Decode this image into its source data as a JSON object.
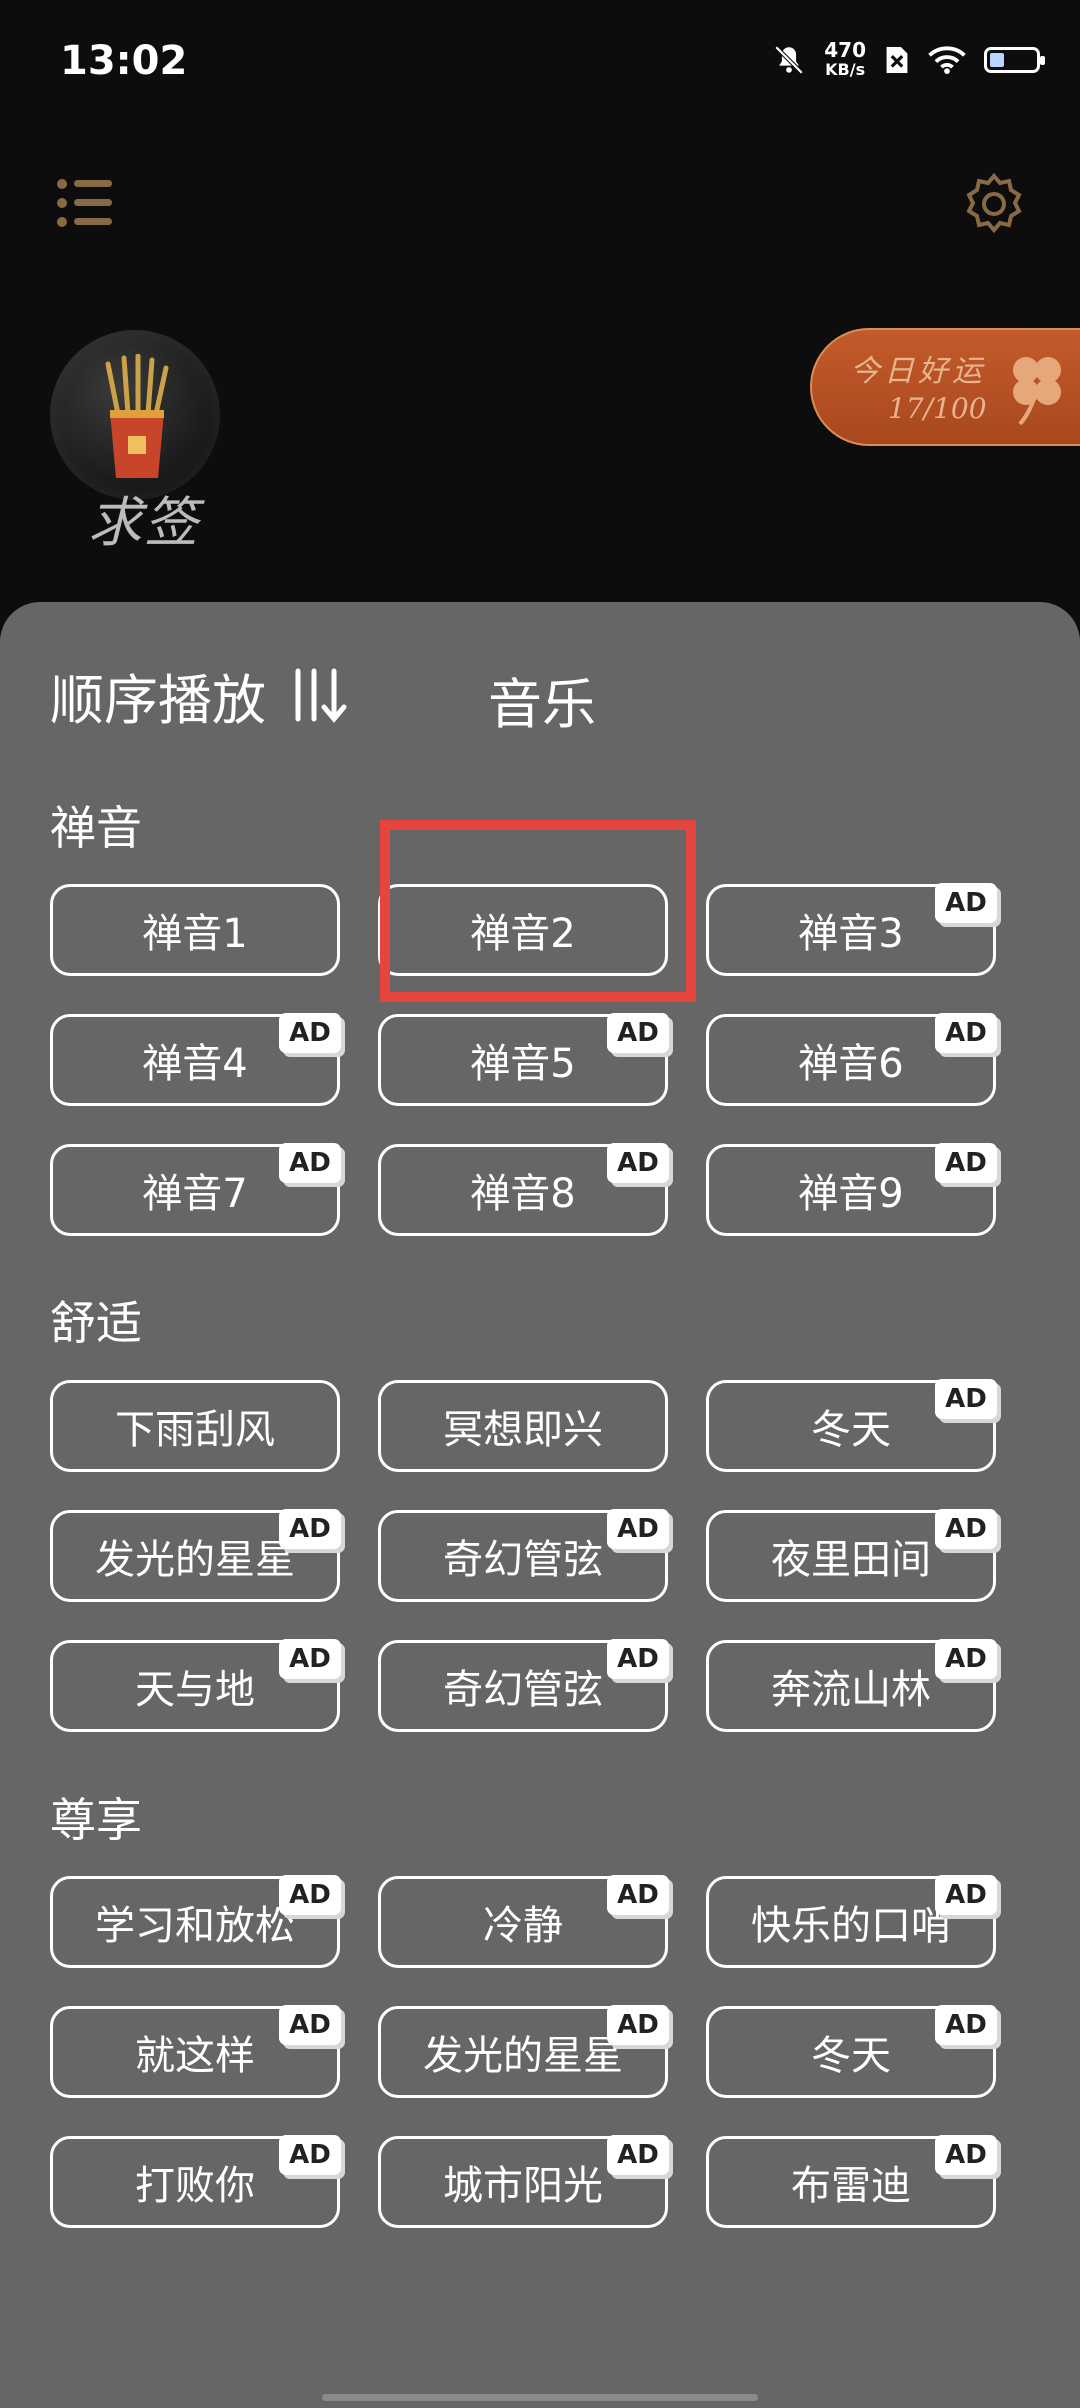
{
  "status_bar": {
    "time": "13:02",
    "net_speed_value": "470",
    "net_speed_unit": "KB/s"
  },
  "top": {
    "fortune_label": "求签",
    "lucky": {
      "title": "今日好运",
      "score": "17/100"
    }
  },
  "sheet": {
    "play_mode": "顺序播放",
    "title": "音乐",
    "ad_label": "AD",
    "sections": [
      {
        "title": "禅音",
        "tracks": [
          {
            "label": "禅音1",
            "ad": false
          },
          {
            "label": "禅音2",
            "ad": false
          },
          {
            "label": "禅音3",
            "ad": true
          },
          {
            "label": "禅音4",
            "ad": true
          },
          {
            "label": "禅音5",
            "ad": true
          },
          {
            "label": "禅音6",
            "ad": true
          },
          {
            "label": "禅音7",
            "ad": true
          },
          {
            "label": "禅音8",
            "ad": true
          },
          {
            "label": "禅音9",
            "ad": true
          }
        ]
      },
      {
        "title": "舒适",
        "tracks": [
          {
            "label": "下雨刮风",
            "ad": false
          },
          {
            "label": "冥想即兴",
            "ad": false
          },
          {
            "label": "冬天",
            "ad": true
          },
          {
            "label": "发光的星星",
            "ad": true
          },
          {
            "label": "奇幻管弦",
            "ad": true
          },
          {
            "label": "夜里田间",
            "ad": true
          },
          {
            "label": "天与地",
            "ad": true
          },
          {
            "label": "奇幻管弦",
            "ad": true
          },
          {
            "label": "奔流山林",
            "ad": true
          }
        ]
      },
      {
        "title": "尊享",
        "tracks": [
          {
            "label": "学习和放松",
            "ad": true
          },
          {
            "label": "冷静",
            "ad": true
          },
          {
            "label": "快乐的口哨",
            "ad": true
          },
          {
            "label": "就这样",
            "ad": true
          },
          {
            "label": "发光的星星",
            "ad": true
          },
          {
            "label": "冬天",
            "ad": true
          },
          {
            "label": "打败你",
            "ad": true
          },
          {
            "label": "城市阳光",
            "ad": true
          },
          {
            "label": "布雷迪",
            "ad": true
          }
        ]
      }
    ]
  },
  "colors": {
    "sheet_bg": "#666666",
    "app_bg": "#0d0d0d",
    "accent_gold": "#a07a4a",
    "highlight_red": "#e5453d"
  }
}
